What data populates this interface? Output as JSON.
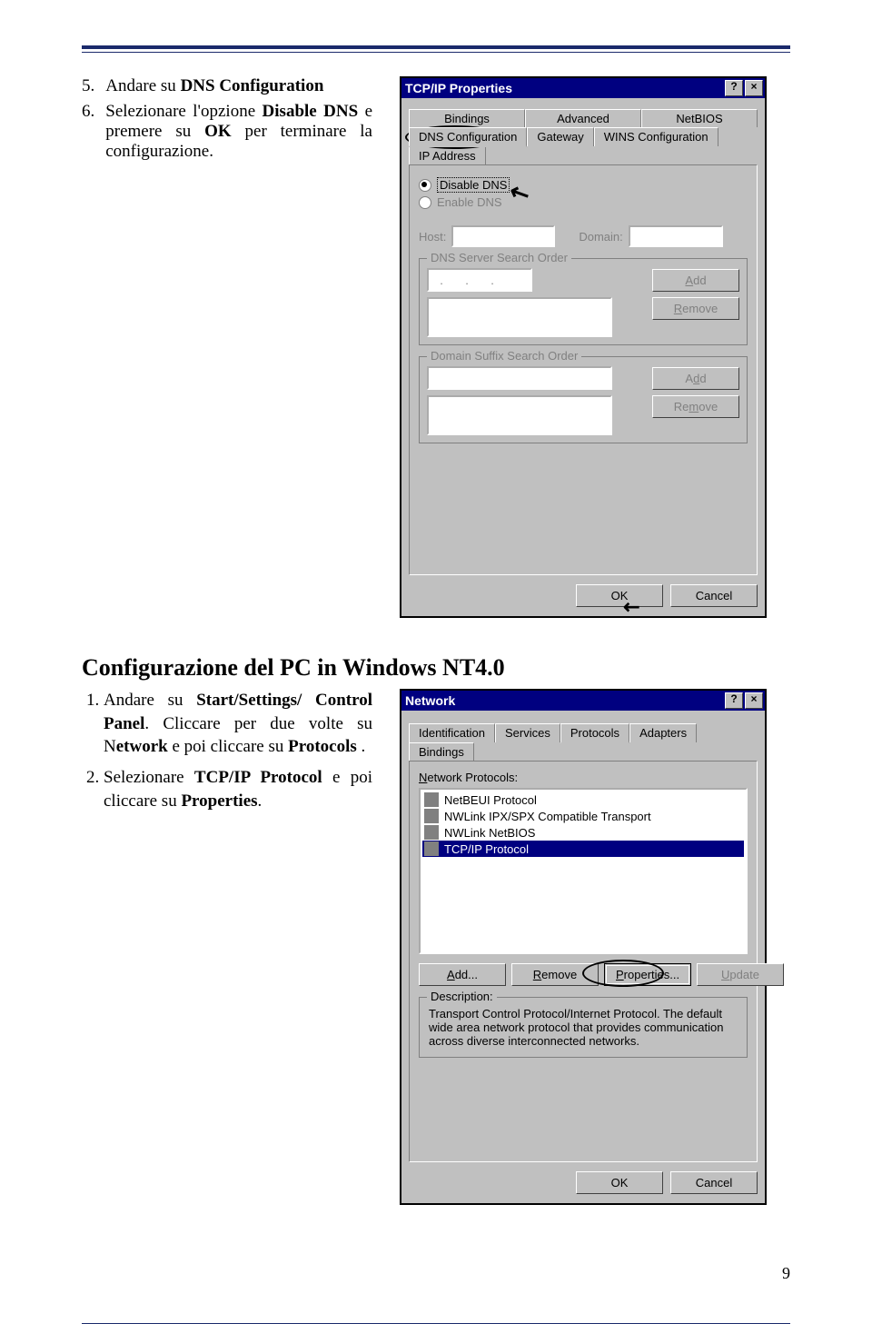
{
  "top": {
    "step5_num": "5.",
    "step5": "Andare su ",
    "step5_b": "DNS Configuration",
    "step6_num": "6.",
    "step6_a": "Selezionare l'opzione ",
    "step6_b": "Disable DNS",
    "step6_c": " e premere su  ",
    "step6_d": "OK",
    "step6_e": " per terminare la configurazione."
  },
  "tcpip": {
    "title": "TCP/IP Properties",
    "help": "?",
    "close": "×",
    "tabs_row1": {
      "bindings": "Bindings",
      "advanced": "Advanced",
      "netbios": "NetBIOS"
    },
    "tabs_row2": {
      "dns": "DNS Configuration",
      "gateway": "Gateway",
      "wins": "WINS Configuration",
      "ip": "IP Address"
    },
    "disable": "Disable DNS",
    "enable": "Enable DNS",
    "host": "Host:",
    "domain": "Domain:",
    "dns_order": "DNS Server Search Order",
    "add": "Add",
    "remove": "Remove",
    "suffix": "Domain Suffix Search Order",
    "ok": "OK",
    "cancel": "Cancel"
  },
  "heading": "Configurazione del  PC in Windows NT4.0",
  "nt": {
    "s1a": "Andare su  ",
    "s1b": "Start/Settings/ Control Panel",
    "s1c": ". Cliccare per  due volte su N",
    "s1d": "etwork",
    "s1e": " e poi cliccare su ",
    "s1f": "Protocols",
    "s1g": " .",
    "s2a": "Selezionare ",
    "s2b": "TCP/IP Protocol",
    "s2c": " e poi cliccare su  ",
    "s2d": "Properties",
    "s2e": "."
  },
  "network": {
    "title": "Network",
    "tabs": {
      "id": "Identification",
      "svc": "Services",
      "proto": "Protocols",
      "adapt": "Adapters",
      "bind": "Bindings"
    },
    "label": "Network Protocols:",
    "items": [
      "NetBEUI Protocol",
      "NWLink IPX/SPX Compatible Transport",
      "NWLink NetBIOS",
      "TCP/IP Protocol"
    ],
    "add": "Add...",
    "remove": "Remove",
    "props": "Properties...",
    "update": "Update",
    "desc_label": "Description:",
    "desc": "Transport Control Protocol/Internet Protocol. The default wide area network protocol that provides communication across diverse interconnected networks.",
    "ok": "OK",
    "cancel": "Cancel"
  },
  "pagenum": "9"
}
